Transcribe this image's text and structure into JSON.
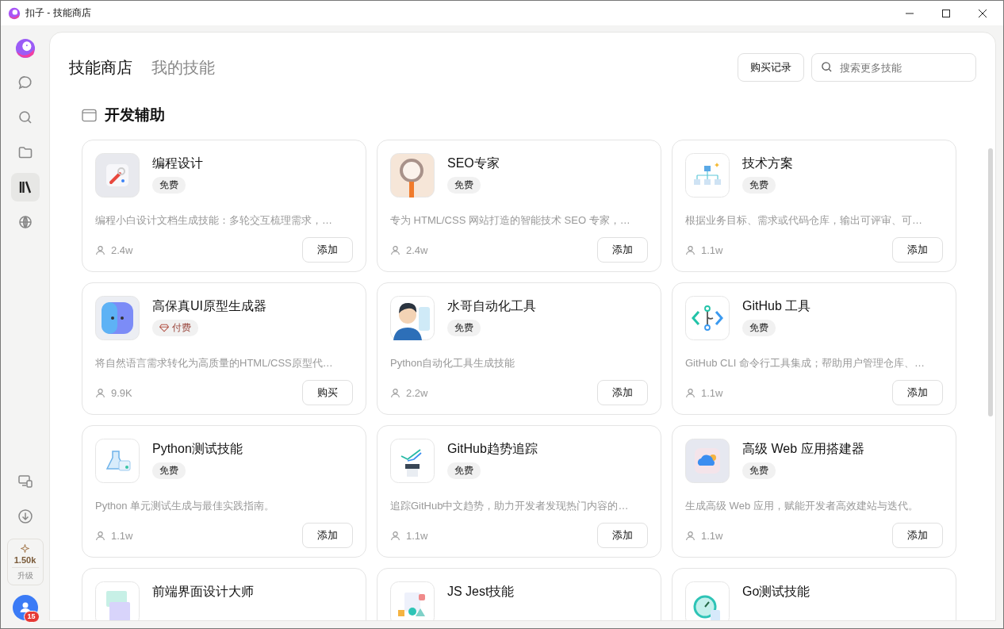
{
  "window": {
    "title": "扣子 - 技能商店"
  },
  "sidebar": {
    "items": [
      {
        "kind": "chat",
        "selected": false
      },
      {
        "kind": "search",
        "selected": false
      },
      {
        "kind": "folder",
        "selected": false
      },
      {
        "kind": "library",
        "selected": true
      },
      {
        "kind": "globe",
        "selected": false
      }
    ],
    "bottom_items": [
      {
        "kind": "devices"
      },
      {
        "kind": "download"
      }
    ],
    "credits": {
      "value": "1.50k",
      "label": "升级"
    },
    "avatar": {
      "badge": "15"
    }
  },
  "tabs": [
    {
      "label": "技能商店",
      "selected": true
    },
    {
      "label": "我的技能",
      "selected": false
    }
  ],
  "purchase_button": "购买记录",
  "search": {
    "placeholder": "搜索更多技能"
  },
  "section": {
    "title": "开发辅助"
  },
  "skills": [
    {
      "name": "编程设计",
      "price": {
        "kind": "free",
        "label": "免费"
      },
      "description": "编程小白设计文档生成技能：多轮交互梳理需求，…",
      "users": "2.4w",
      "action": "添加"
    },
    {
      "name": "SEO专家",
      "price": {
        "kind": "free",
        "label": "免费"
      },
      "description": "专为 HTML/CSS 网站打造的智能技术 SEO 专家，…",
      "users": "2.4w",
      "action": "添加"
    },
    {
      "name": "技术方案",
      "price": {
        "kind": "free",
        "label": "免费"
      },
      "description": "根据业务目标、需求或代码仓库，输出可评审、可…",
      "users": "1.1w",
      "action": "添加"
    },
    {
      "name": "高保真UI原型生成器",
      "price": {
        "kind": "paid",
        "label": "付费"
      },
      "description": "将自然语言需求转化为高质量的HTML/CSS原型代…",
      "users": "9.9K",
      "action": "购买"
    },
    {
      "name": "水哥自动化工具",
      "price": {
        "kind": "free",
        "label": "免费"
      },
      "description": "Python自动化工具生成技能",
      "users": "2.2w",
      "action": "添加"
    },
    {
      "name": "GitHub 工具",
      "price": {
        "kind": "free",
        "label": "免费"
      },
      "description": "GitHub CLI 命令行工具集成；帮助用户管理仓库、…",
      "users": "1.1w",
      "action": "添加"
    },
    {
      "name": "Python测试技能",
      "price": {
        "kind": "free",
        "label": "免费"
      },
      "description": "Python 单元测试生成与最佳实践指南。",
      "users": "1.1w",
      "action": "添加"
    },
    {
      "name": "GitHub趋势追踪",
      "price": {
        "kind": "free",
        "label": "免费"
      },
      "description": "追踪GitHub中文趋势，助力开发者发现热门内容的…",
      "users": "1.1w",
      "action": "添加"
    },
    {
      "name": "高级 Web 应用搭建器",
      "price": {
        "kind": "free",
        "label": "免费"
      },
      "description": "生成高级 Web 应用，赋能开发者高效建站与迭代。",
      "users": "1.1w",
      "action": "添加"
    },
    {
      "name": "前端界面设计大师"
    },
    {
      "name": "JS Jest技能"
    },
    {
      "name": "Go测试技能"
    }
  ]
}
